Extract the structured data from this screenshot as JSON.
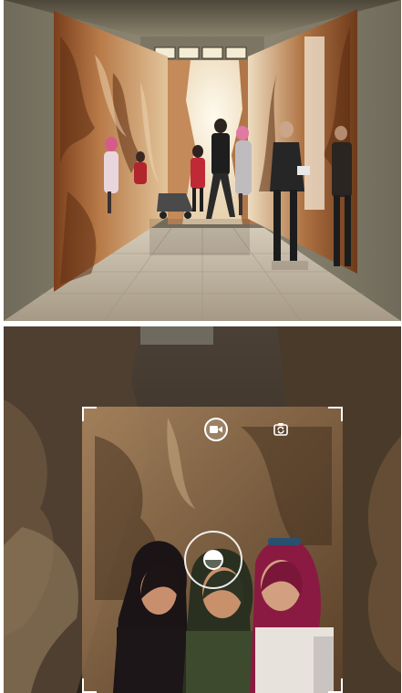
{
  "rendering": {
    "description_icon": "gallery-corridor-rendering"
  },
  "camera": {
    "mode_icon": "video-camera-icon",
    "switch_icon": "switch-camera-icon",
    "shutter_icon": "shutter-button"
  },
  "colors": {
    "overlay_white": "#ffffff",
    "rock_dark": "#3a3024",
    "rock_warm": "#9a6a3e",
    "floor": "#b9ad9a"
  }
}
